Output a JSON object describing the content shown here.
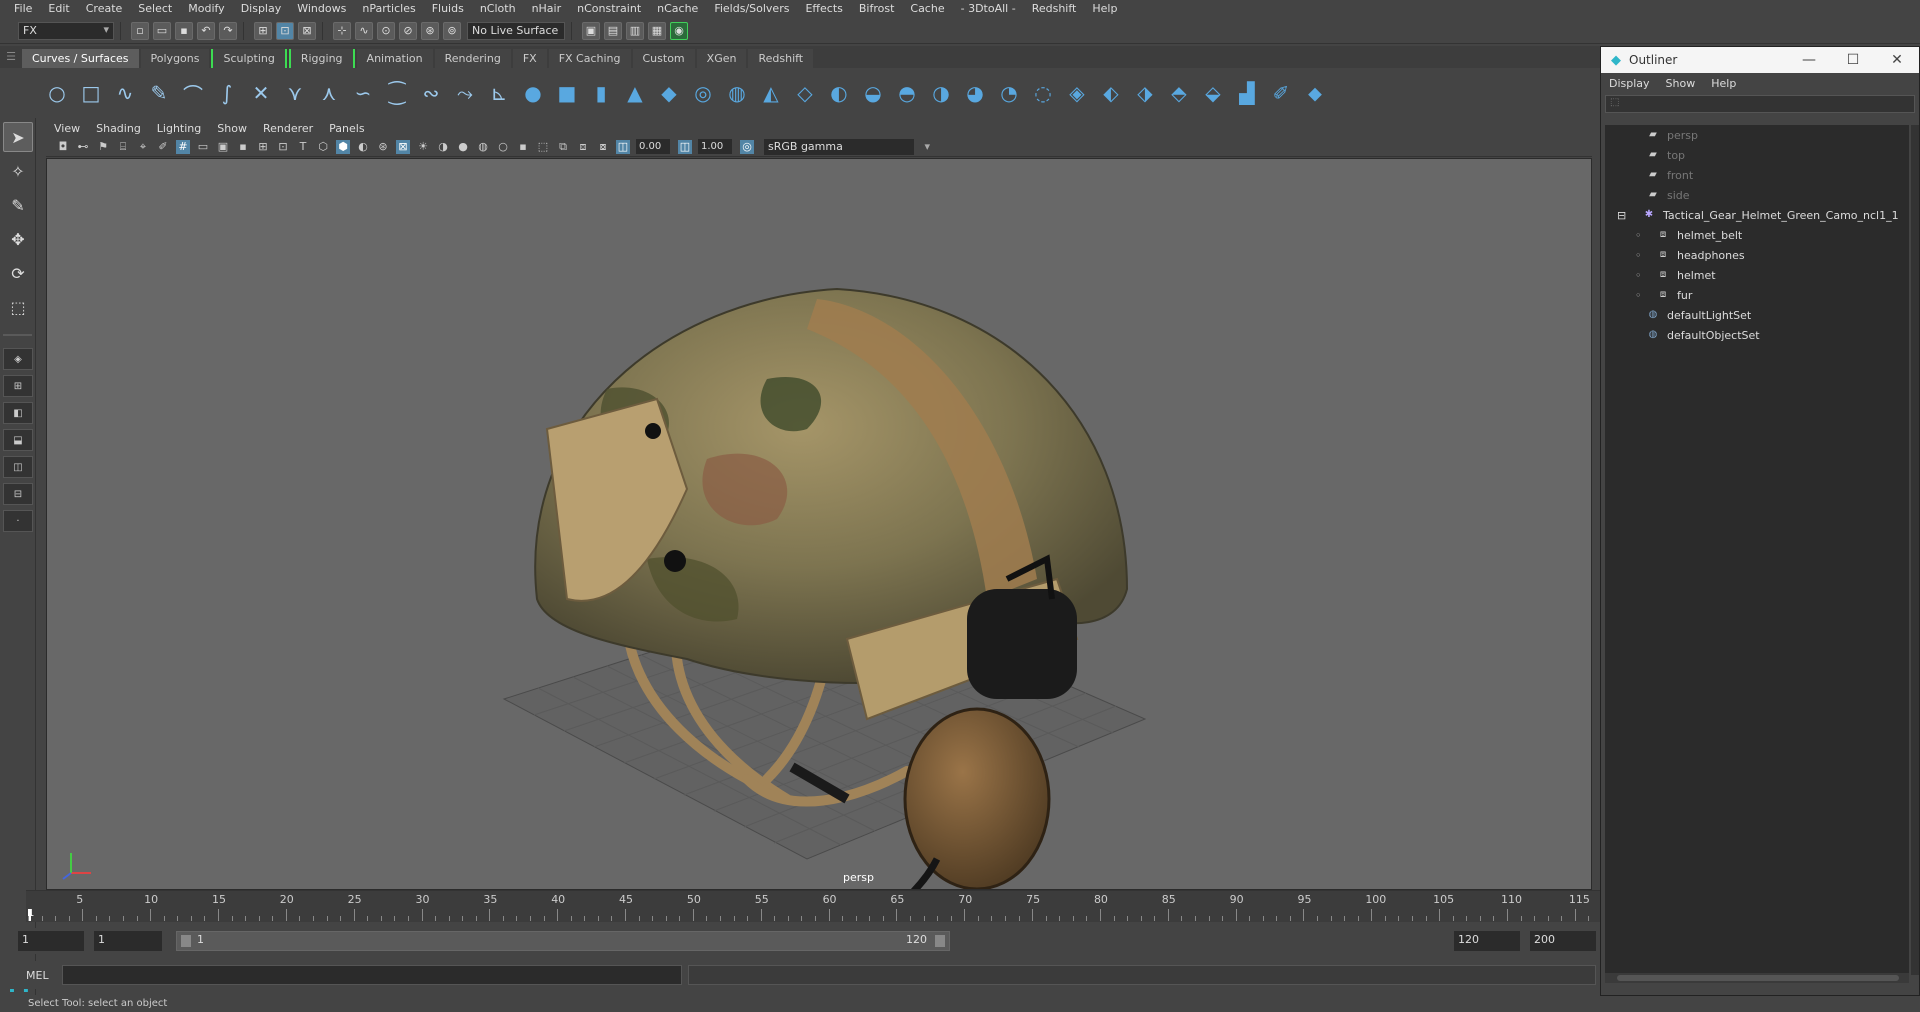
{
  "menubar": [
    "File",
    "Edit",
    "Create",
    "Select",
    "Modify",
    "Display",
    "Windows",
    "nParticles",
    "Fluids",
    "nCloth",
    "nHair",
    "nConstraint",
    "nCache",
    "Fields/Solvers",
    "Effects",
    "Bifrost",
    "Cache",
    "- 3DtoAll -",
    "Redshift",
    "Help"
  ],
  "statusline": {
    "mode": "FX",
    "live_surface": "No Live Surface"
  },
  "shelf_tabs": [
    {
      "label": "Curves / Surfaces",
      "active": true
    },
    {
      "label": "Polygons"
    },
    {
      "label": "Sculpting",
      "bracket": true
    },
    {
      "label": "Rigging",
      "bracket": true
    },
    {
      "label": "Animation"
    },
    {
      "label": "Rendering"
    },
    {
      "label": "FX"
    },
    {
      "label": "FX Caching"
    },
    {
      "label": "Custom"
    },
    {
      "label": "XGen"
    },
    {
      "label": "Redshift"
    }
  ],
  "viewport": {
    "menu": [
      "View",
      "Shading",
      "Lighting",
      "Show",
      "Renderer",
      "Panels"
    ],
    "exposure": "0.00",
    "gamma": "1.00",
    "color_space": "sRGB gamma",
    "camera_label": "persp"
  },
  "timeslider": {
    "ticks": [
      "5",
      "10",
      "15",
      "20",
      "25",
      "30",
      "35",
      "40",
      "45",
      "50",
      "55",
      "60",
      "65",
      "70",
      "75",
      "80",
      "85",
      "90",
      "95",
      "100",
      "105",
      "110",
      "115"
    ],
    "current_frame": "1"
  },
  "range": {
    "start": "1",
    "playback_start": "1",
    "slider_start": "1",
    "slider_end": "120",
    "playback_end": "120",
    "end": "200"
  },
  "cmdline": {
    "lang": "MEL"
  },
  "helpline": "Select Tool: select an object",
  "outliner": {
    "title": "Outliner",
    "menu": [
      "Display",
      "Show",
      "Help"
    ],
    "items": [
      {
        "label": "persp",
        "type": "camera",
        "indent": 0
      },
      {
        "label": "top",
        "type": "camera",
        "indent": 0
      },
      {
        "label": "front",
        "type": "camera",
        "indent": 0
      },
      {
        "label": "side",
        "type": "camera",
        "indent": 0
      },
      {
        "label": "Tactical_Gear_Helmet_Green_Camo_ncl1_1",
        "type": "group",
        "indent": 0,
        "expanded": true
      },
      {
        "label": "helmet_belt",
        "type": "mesh",
        "indent": 1
      },
      {
        "label": "headphones",
        "type": "mesh",
        "indent": 1
      },
      {
        "label": "helmet",
        "type": "mesh",
        "indent": 1
      },
      {
        "label": "fur",
        "type": "mesh",
        "indent": 1
      },
      {
        "label": "defaultLightSet",
        "type": "set",
        "indent": 0
      },
      {
        "label": "defaultObjectSet",
        "type": "set",
        "indent": 0
      }
    ]
  },
  "colors": {
    "accent": "#5285a6",
    "shelf_icon": "#59a8e0",
    "bracket": "#3ddc52",
    "viewport_bg": "#686868"
  }
}
